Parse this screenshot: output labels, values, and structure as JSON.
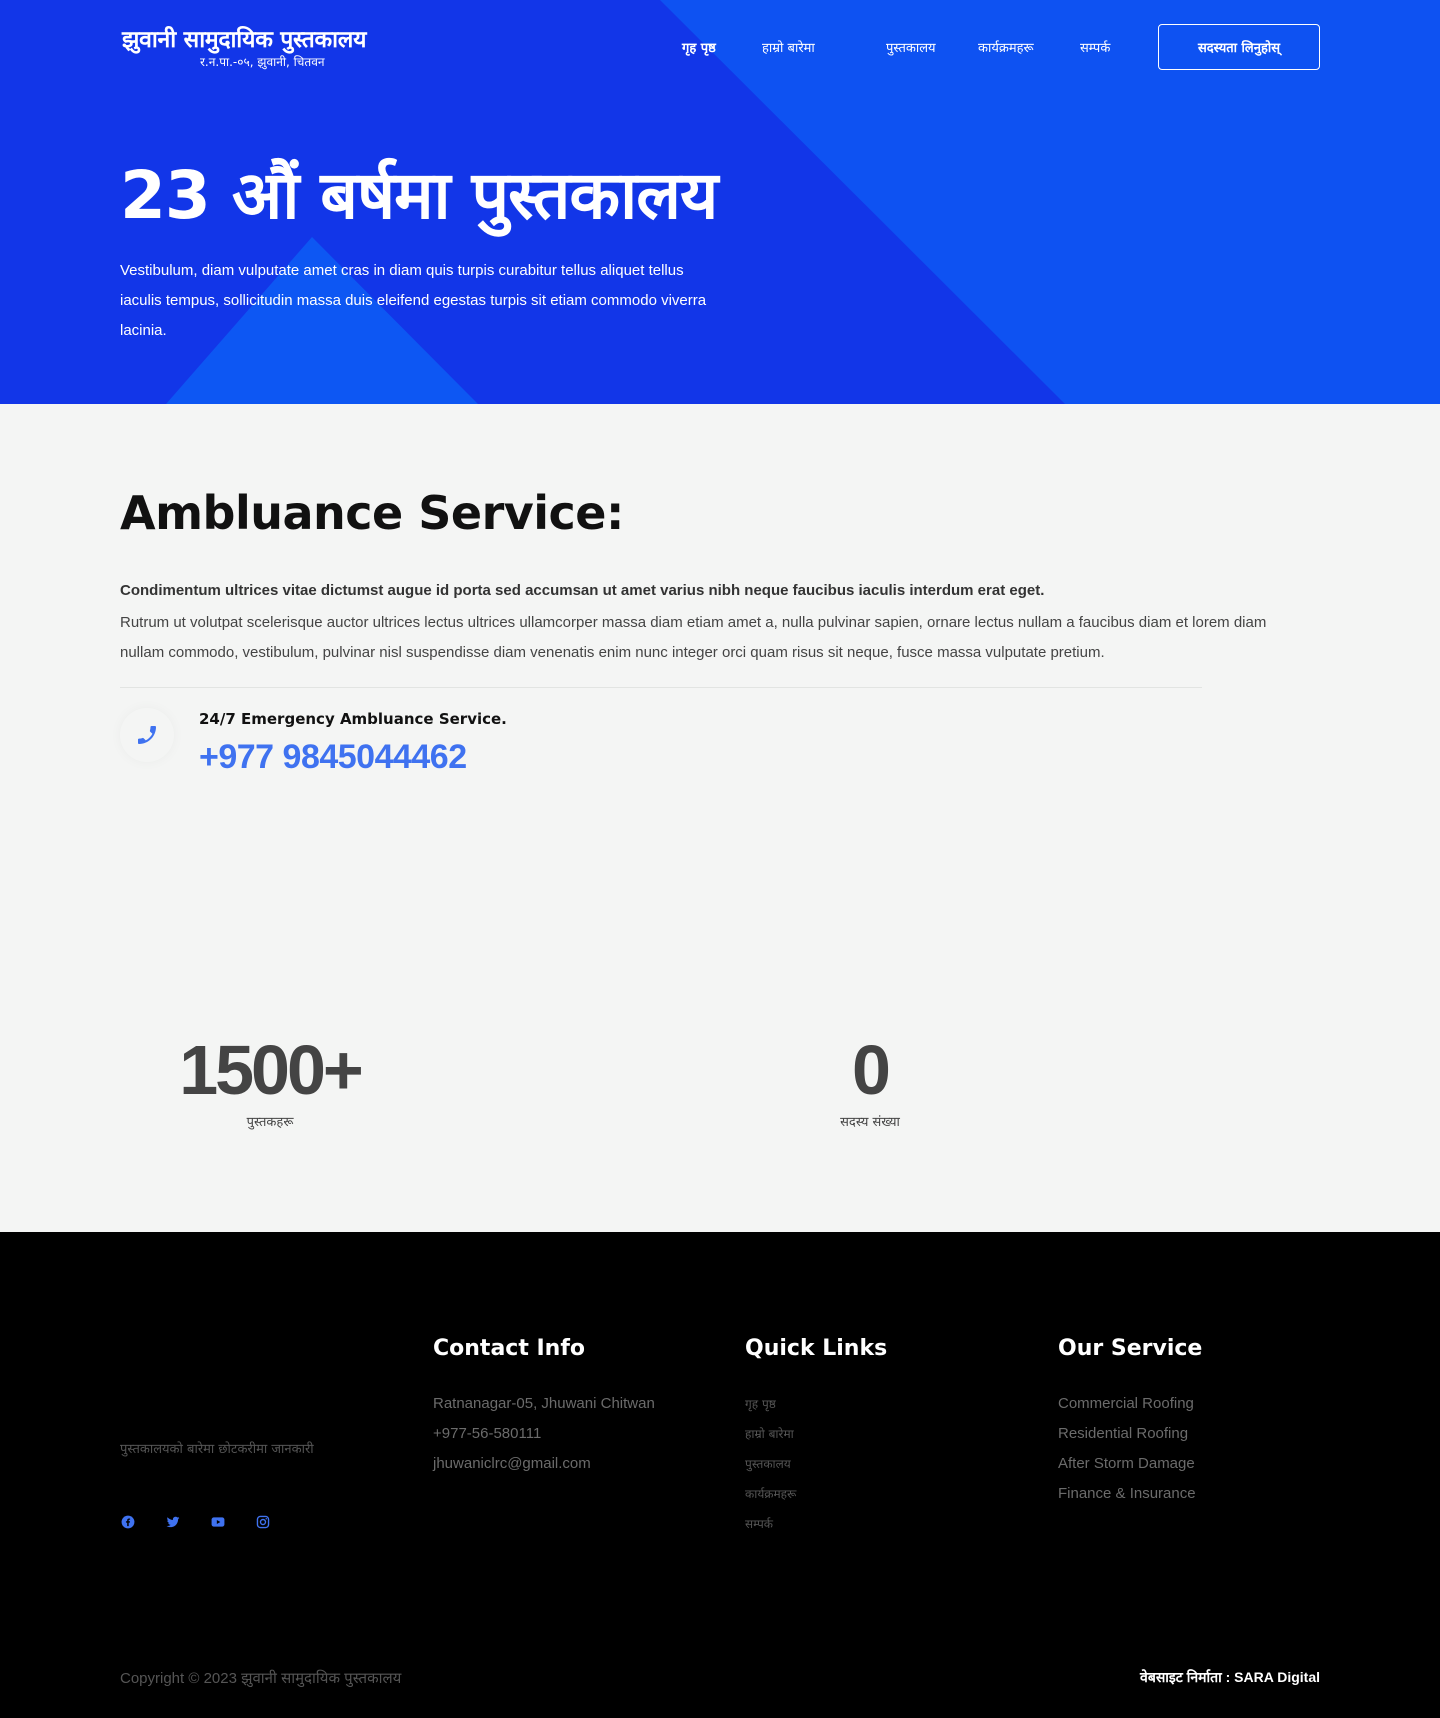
{
  "header": {
    "logo_title": "झुवानी सामुदायिक पुस्तकालय",
    "logo_subtitle": "र.न.पा.-०५, झुवानी, चितवन",
    "nav": [
      {
        "label": "गृह पृष्ठ",
        "active": true
      },
      {
        "label": "हाम्रो बारेमा",
        "active": false
      },
      {
        "label": "पुस्तकालय",
        "active": false
      },
      {
        "label": "कार्यक्रमहरू",
        "active": false
      },
      {
        "label": "सम्पर्क",
        "active": false
      }
    ],
    "cta_label": "सदस्यता लिनुहोस्"
  },
  "hero": {
    "title": "23 औं बर्षमा पुस्तकालय",
    "text": "Vestibulum, diam vulputate amet cras in diam quis turpis curabitur tellus aliquet tellus iaculis tempus, sollicitudin massa duis eleifend egestas turpis sit etiam commodo viverra lacinia."
  },
  "ambulance": {
    "title": "Ambluance Service:",
    "lead": "Condimentum ultrices vitae dictumst augue id porta sed accumsan ut amet varius nibh neque faucibus iaculis interdum erat eget.",
    "body": "Rutrum ut volutpat scelerisque auctor ultrices lectus ultrices ullamcorper massa diam etiam amet a, nulla pulvinar sapien, ornare lectus nullam a faucibus diam et lorem diam nullam commodo, vestibulum, pulvinar nisl suspendisse diam venenatis enim nunc integer orci quam risus sit neque, fusce massa vulputate pretium.",
    "emergency_label": "24/7 Emergency Ambluance Service.",
    "phone": "+977 9845044462",
    "phone_icon": "phone-icon"
  },
  "stats": [
    {
      "value": "1500+",
      "label": "पुस्तकहरू"
    },
    {
      "value": "0",
      "label": "सदस्य संख्या"
    }
  ],
  "footer": {
    "about": "पुस्तकालयको बारेमा छोटकरीमा जानकारी",
    "socials": [
      "facebook-icon",
      "twitter-icon",
      "youtube-icon",
      "instagram-icon"
    ],
    "contact": {
      "title": "Contact Info",
      "items": [
        "Ratnanagar-05, Jhuwani Chitwan",
        "+977-56-580111",
        "jhuwaniclrc@gmail.com"
      ]
    },
    "quick_links": {
      "title": "Quick Links",
      "items": [
        "गृह पृष्ठ",
        "हाम्रो बारेमा",
        "पुस्तकालय",
        "कार्यक्रमहरू",
        "सम्पर्क"
      ]
    },
    "service": {
      "title": "Our Service",
      "items": [
        "Commercial Roofing",
        "Residential Roofing",
        "After Storm Damage",
        "Finance & Insurance"
      ]
    },
    "copyright": "Copyright © 2023 झुवानी सामुदायिक पुस्तकालय",
    "credit": "वेबसाइट निर्माता : SARA Digital"
  },
  "colors": {
    "hero_bg": "#1236e8",
    "accent": "#3f72f0",
    "footer_bg": "#000000"
  }
}
